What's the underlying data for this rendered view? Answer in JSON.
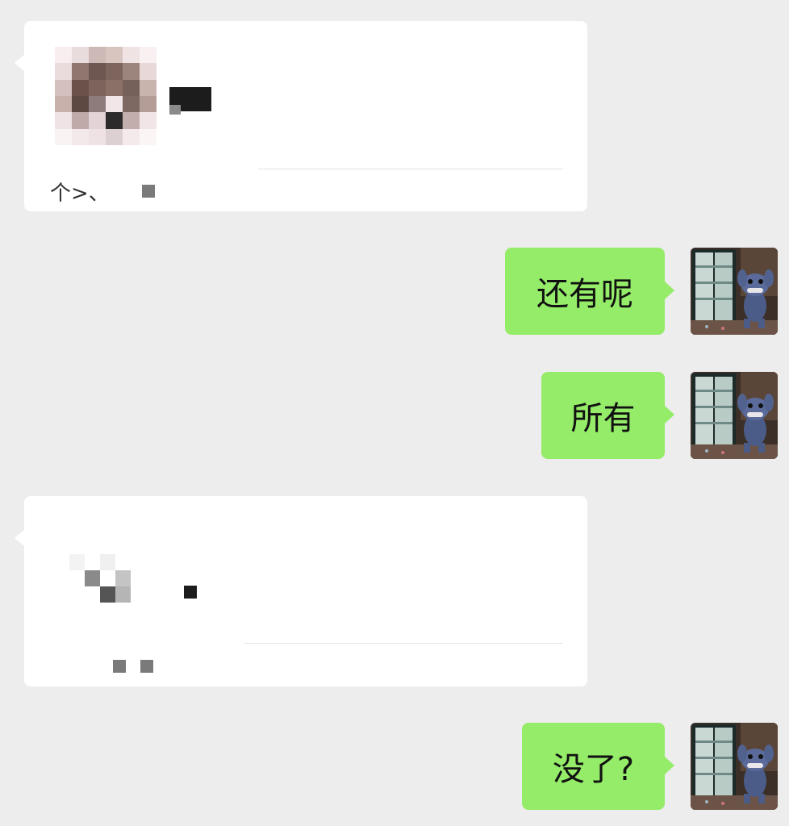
{
  "conversation": {
    "messages": [
      {
        "direction": "incoming",
        "kind": "card",
        "footer_text": "个>、"
      },
      {
        "direction": "outgoing",
        "kind": "text",
        "text": "还有呢"
      },
      {
        "direction": "outgoing",
        "kind": "text",
        "text": "所有"
      },
      {
        "direction": "incoming",
        "kind": "card",
        "footer_text": ""
      },
      {
        "direction": "outgoing",
        "kind": "text",
        "text": "没了?"
      }
    ]
  },
  "colors": {
    "background": "#ededed",
    "outgoing_bubble": "#95ec69",
    "incoming_bubble": "#ffffff"
  },
  "icons": {
    "avatar": "blue-alien-character-at-fridge-avatar"
  }
}
